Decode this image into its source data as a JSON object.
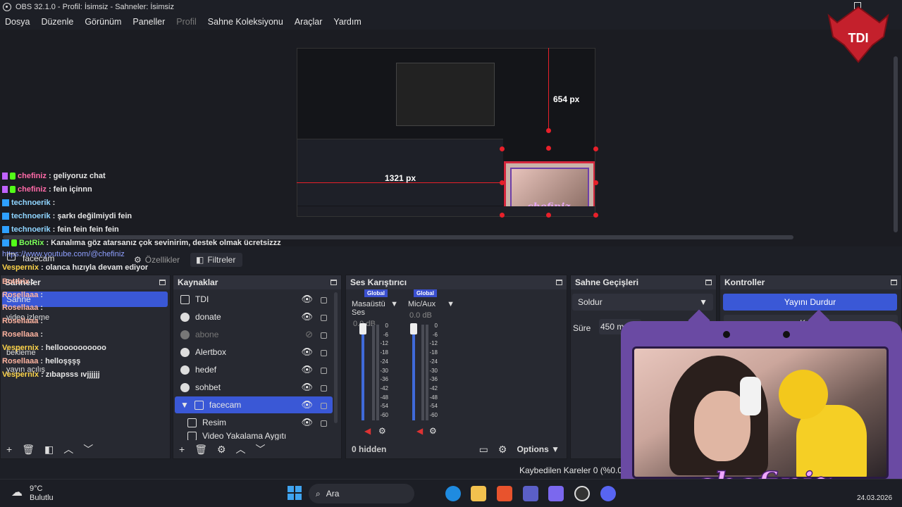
{
  "window": {
    "title": "OBS 32.1.0 - Profil: İsimsiz - Sahneler: İsimsiz"
  },
  "menu": {
    "items": [
      "Dosya",
      "Düzenle",
      "Görünüm",
      "Paneller",
      "Profil",
      "Sahne Koleksiyonu",
      "Araçlar",
      "Yardım"
    ]
  },
  "overlay_logo": "TDI",
  "preview": {
    "label_height": "654 px",
    "label_width": "1321 px",
    "nested_cam_text": "chefiniz"
  },
  "chat": [
    {
      "user": "chefiniz",
      "msg": ": geliyoruz chat"
    },
    {
      "user": "chefiniz",
      "msg": ": fein içinnn"
    },
    {
      "user": "technoerik",
      "msg": ":"
    },
    {
      "user": "technoerik",
      "msg": ": şarkı değilmiydi fein"
    },
    {
      "user": "technoerik",
      "msg": ": fein fein fein fein"
    },
    {
      "user": "BotRix",
      "msg": ": Kanalıma göz atarsanız çok sevinirim, destek olmak ücretsizzz"
    },
    {
      "user": "",
      "msg": "https://www.youtube.com/@chefiniz"
    },
    {
      "user": "Vespernix",
      "msg": ": olanca hızıyla devam ediyor"
    },
    {
      "user": "Botdrix",
      "msg": ":"
    },
    {
      "user": "Rosellaaa",
      "msg": ":"
    },
    {
      "user": "Rosellaaa",
      "msg": ":"
    },
    {
      "user": "Rosellaaa",
      "msg": ":"
    },
    {
      "user": "Rosellaaa",
      "msg": ":"
    },
    {
      "user": "Vespernix",
      "msg": ": helloooooooooo"
    },
    {
      "user": "Rosellaaa",
      "msg": ": helloşşşş"
    },
    {
      "user": "Vespernix",
      "msg": ": zıbapsss ıvjjjjjj"
    }
  ],
  "source_toolbar": {
    "selected_source": "facecam",
    "properties": "Özellikler",
    "filters": "Filtreler"
  },
  "scenes": {
    "title": "Sahneler",
    "items": [
      "Sahne",
      "video izleme",
      "bekleme",
      "yayın açılış"
    ]
  },
  "sources": {
    "title": "Kaynaklar",
    "items": [
      "TDI",
      "donate",
      "abone",
      "Alertbox",
      "hedef",
      "sohbet",
      "facecam",
      "Resim",
      "Video Yakalama Aygıtı"
    ]
  },
  "mixer": {
    "title": "Ses Karıştırıcı",
    "channels": [
      {
        "badge": "Global",
        "name": "Masaüstü Ses",
        "db": "0.0 dB"
      },
      {
        "badge": "Global",
        "name": "Mic/Aux",
        "db": "0.0 dB"
      }
    ],
    "scale": [
      "0",
      "-6",
      "-12",
      "-18",
      "-24",
      "-30",
      "-36",
      "-42",
      "-48",
      "-54",
      "-60"
    ],
    "hidden": "0 hidden",
    "options": "Options"
  },
  "transitions": {
    "title": "Sahne Geçişleri",
    "selected": "Soldur",
    "duration_label": "Süre",
    "duration": "450 ms"
  },
  "controls": {
    "title": "Kontroller",
    "stream_button": "Yayını Durdur",
    "record_button": "Kaydı"
  },
  "status": {
    "dropped": "Kaybedilen Kareler 0 (%0.0)"
  },
  "webcam_overlay": {
    "name": "chefiniz"
  },
  "taskbar": {
    "weather_temp": "9°C",
    "weather_desc": "Bulutlu",
    "search": "Ara",
    "date": "24.03.2026"
  }
}
